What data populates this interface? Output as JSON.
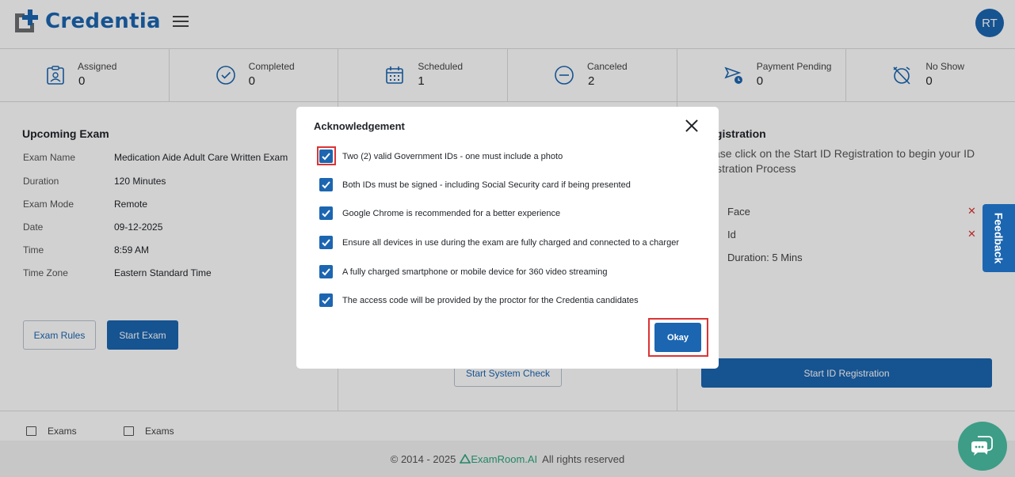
{
  "header": {
    "brand": "Credentia",
    "avatar_initials": "RT"
  },
  "stats": [
    {
      "label": "Assigned",
      "value": "0",
      "icon": "clipboard-user-icon"
    },
    {
      "label": "Completed",
      "value": "0",
      "icon": "check-circle-icon"
    },
    {
      "label": "Scheduled",
      "value": "1",
      "icon": "calendar-icon"
    },
    {
      "label": "Canceled",
      "value": "2",
      "icon": "minus-circle-icon"
    },
    {
      "label": "Payment Pending",
      "value": "0",
      "icon": "payment-pending-icon"
    },
    {
      "label": "No Show",
      "value": "0",
      "icon": "alarm-off-icon"
    }
  ],
  "upcoming": {
    "title": "Upcoming Exam",
    "rows": [
      {
        "key": "Exam Name",
        "value": "Medication Aide Adult Care Written Exam"
      },
      {
        "key": "Duration",
        "value": "120 Minutes"
      },
      {
        "key": "Exam Mode",
        "value": "Remote"
      },
      {
        "key": "Date",
        "value": "09-12-2025"
      },
      {
        "key": "Time",
        "value": "8:59 AM"
      },
      {
        "key": "Time Zone",
        "value": "Eastern Standard Time"
      }
    ],
    "rules_button": "Exam Rules",
    "start_button": "Start Exam"
  },
  "system_check": {
    "button": "Start System Check"
  },
  "registration": {
    "title": "Registration",
    "desc_line1": "ase click on the Start ID Registration to begin your ID",
    "desc_line2": "istration Process",
    "requirements": [
      "Face",
      "Id"
    ],
    "duration": "Duration: 5 Mins",
    "button": "Start ID Registration"
  },
  "tabs": [
    "Exams",
    "Exams"
  ],
  "footer": {
    "copyright": "© 2014 - 2025",
    "brand": "ExamRoom.AI",
    "rights": "All rights reserved"
  },
  "feedback": "Feedback",
  "modal": {
    "title": "Acknowledgement",
    "items": [
      "Two (2) valid Government IDs - one must include a photo",
      "Both IDs must be signed - including Social Security card if being presented",
      "Google Chrome is recommended for a better experience",
      "Ensure all devices in use during the exam are fully charged and connected to a charger",
      "A fully charged smartphone or mobile device for 360 video streaming",
      "The access code will be provided by the proctor for the Credentia candidates"
    ],
    "okay_button": "Okay"
  },
  "colors": {
    "brand_blue": "#1c66b1",
    "highlight_red": "#dd3333",
    "chat_green": "#3d9d86"
  }
}
